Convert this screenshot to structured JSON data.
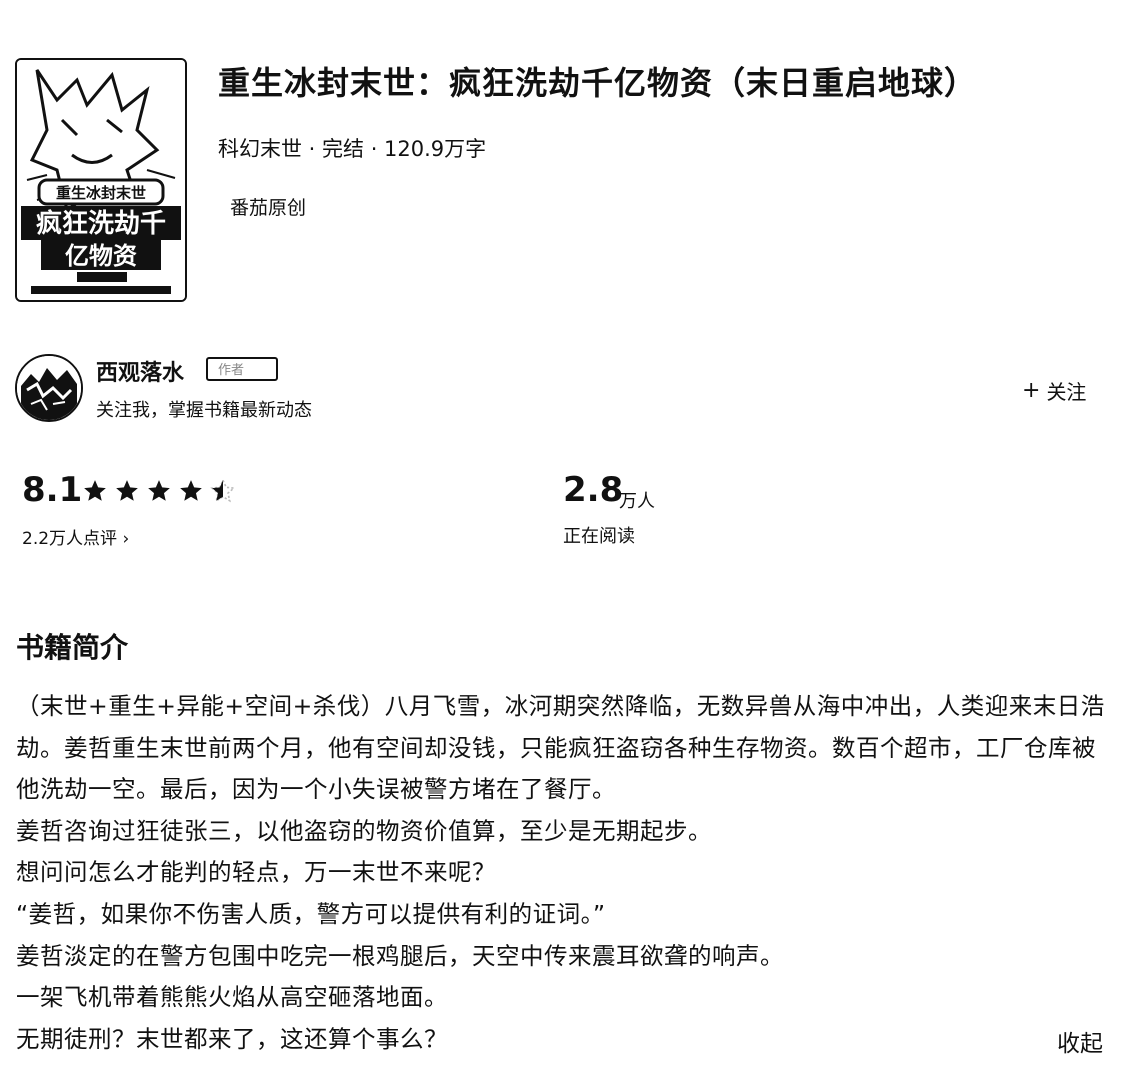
{
  "book": {
    "title": "重生冰封末世：疯狂洗劫千亿物资（末日重启地球）",
    "meta": "科幻末世 · 完结 · 120.9万字",
    "source": "番茄原创",
    "cover_text": {
      "line1": "重生冰封末世",
      "line2": "疯狂洗劫千",
      "line3": "亿物资"
    }
  },
  "author": {
    "name": "西观落水",
    "badge": "作者",
    "description": "关注我，掌握书籍最新动态",
    "follow_label": "关注",
    "follow_icon": "plus-icon"
  },
  "stats": {
    "score": "8.1",
    "rating_stars": 4.5,
    "reviews_label": "2.2万人点评",
    "reviews_icon": "chevron-right-icon",
    "readers_number": "2.8",
    "readers_unit": "万人",
    "readers_label": "正在阅读"
  },
  "synopsis": {
    "heading": "书籍简介",
    "paragraphs": [
      "（末世+重生+异能+空间+杀伐）八月飞雪，冰河期突然降临，无数异兽从海中冲出，人类迎来末日浩劫。姜哲重生末世前两个月，他有空间却没钱，只能疯狂盗窃各种生存物资。数百个超市，工厂仓库被他洗劫一空。最后，因为一个小失误被警方堵在了餐厅。",
      "姜哲咨询过狂徒张三，以他盗窃的物资价值算，至少是无期起步。",
      "想问问怎么才能判的轻点，万一末世不来呢？",
      "“姜哲，如果你不伤害人质，警方可以提供有利的证词。”",
      "姜哲淡定的在警方包围中吃完一根鸡腿后，天空中传来震耳欲聋的响声。",
      "一架飞机带着熊熊火焰从高空砸落地面。",
      "无期徒刑？末世都来了，这还算个事么？"
    ],
    "collapse_label": "收起"
  }
}
